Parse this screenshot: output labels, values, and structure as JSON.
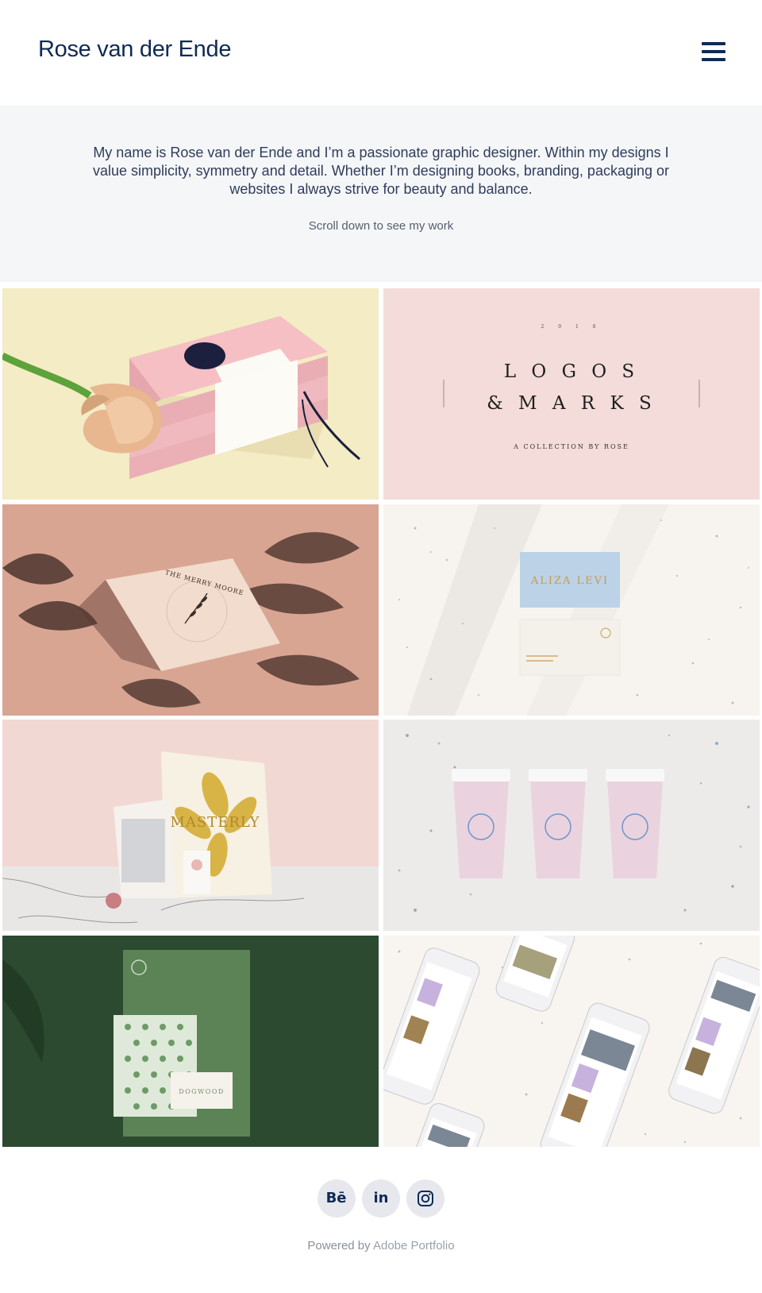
{
  "header": {
    "site_title": "Rose van der Ende",
    "menu_icon": "hamburger-menu-icon"
  },
  "intro": {
    "text": "My name is Rose van der Ende and I’m a passionate graphic designer. Within my designs I value simplicity, symmetry and detail. Whether I’m designing books, branding, packaging or websites I always strive for beauty and balance.",
    "scroll_hint": "Scroll down to see my work"
  },
  "gallery": {
    "logos_card": {
      "title_line1": "L O G O S",
      "title_line2": "& M A R K S",
      "subtitle": "A COLLECTION BY ROSE"
    },
    "business_card_brand": "ALIZA LEVI",
    "stationery_brand": "MASTERLY",
    "dogwood_label": "DOGWOOD",
    "invitation_text": "THE MERRY MOORE"
  },
  "social": {
    "behance_label": "Bē",
    "linkedin_label": "in",
    "instagram_icon": "instagram-icon"
  },
  "footer": {
    "powered_by": "Powered by",
    "link_text": "Adobe Portfolio"
  },
  "colors": {
    "title_navy": "#0f2a55",
    "intro_bg": "#f5f6f8",
    "social_bg": "#e6e8ee"
  }
}
